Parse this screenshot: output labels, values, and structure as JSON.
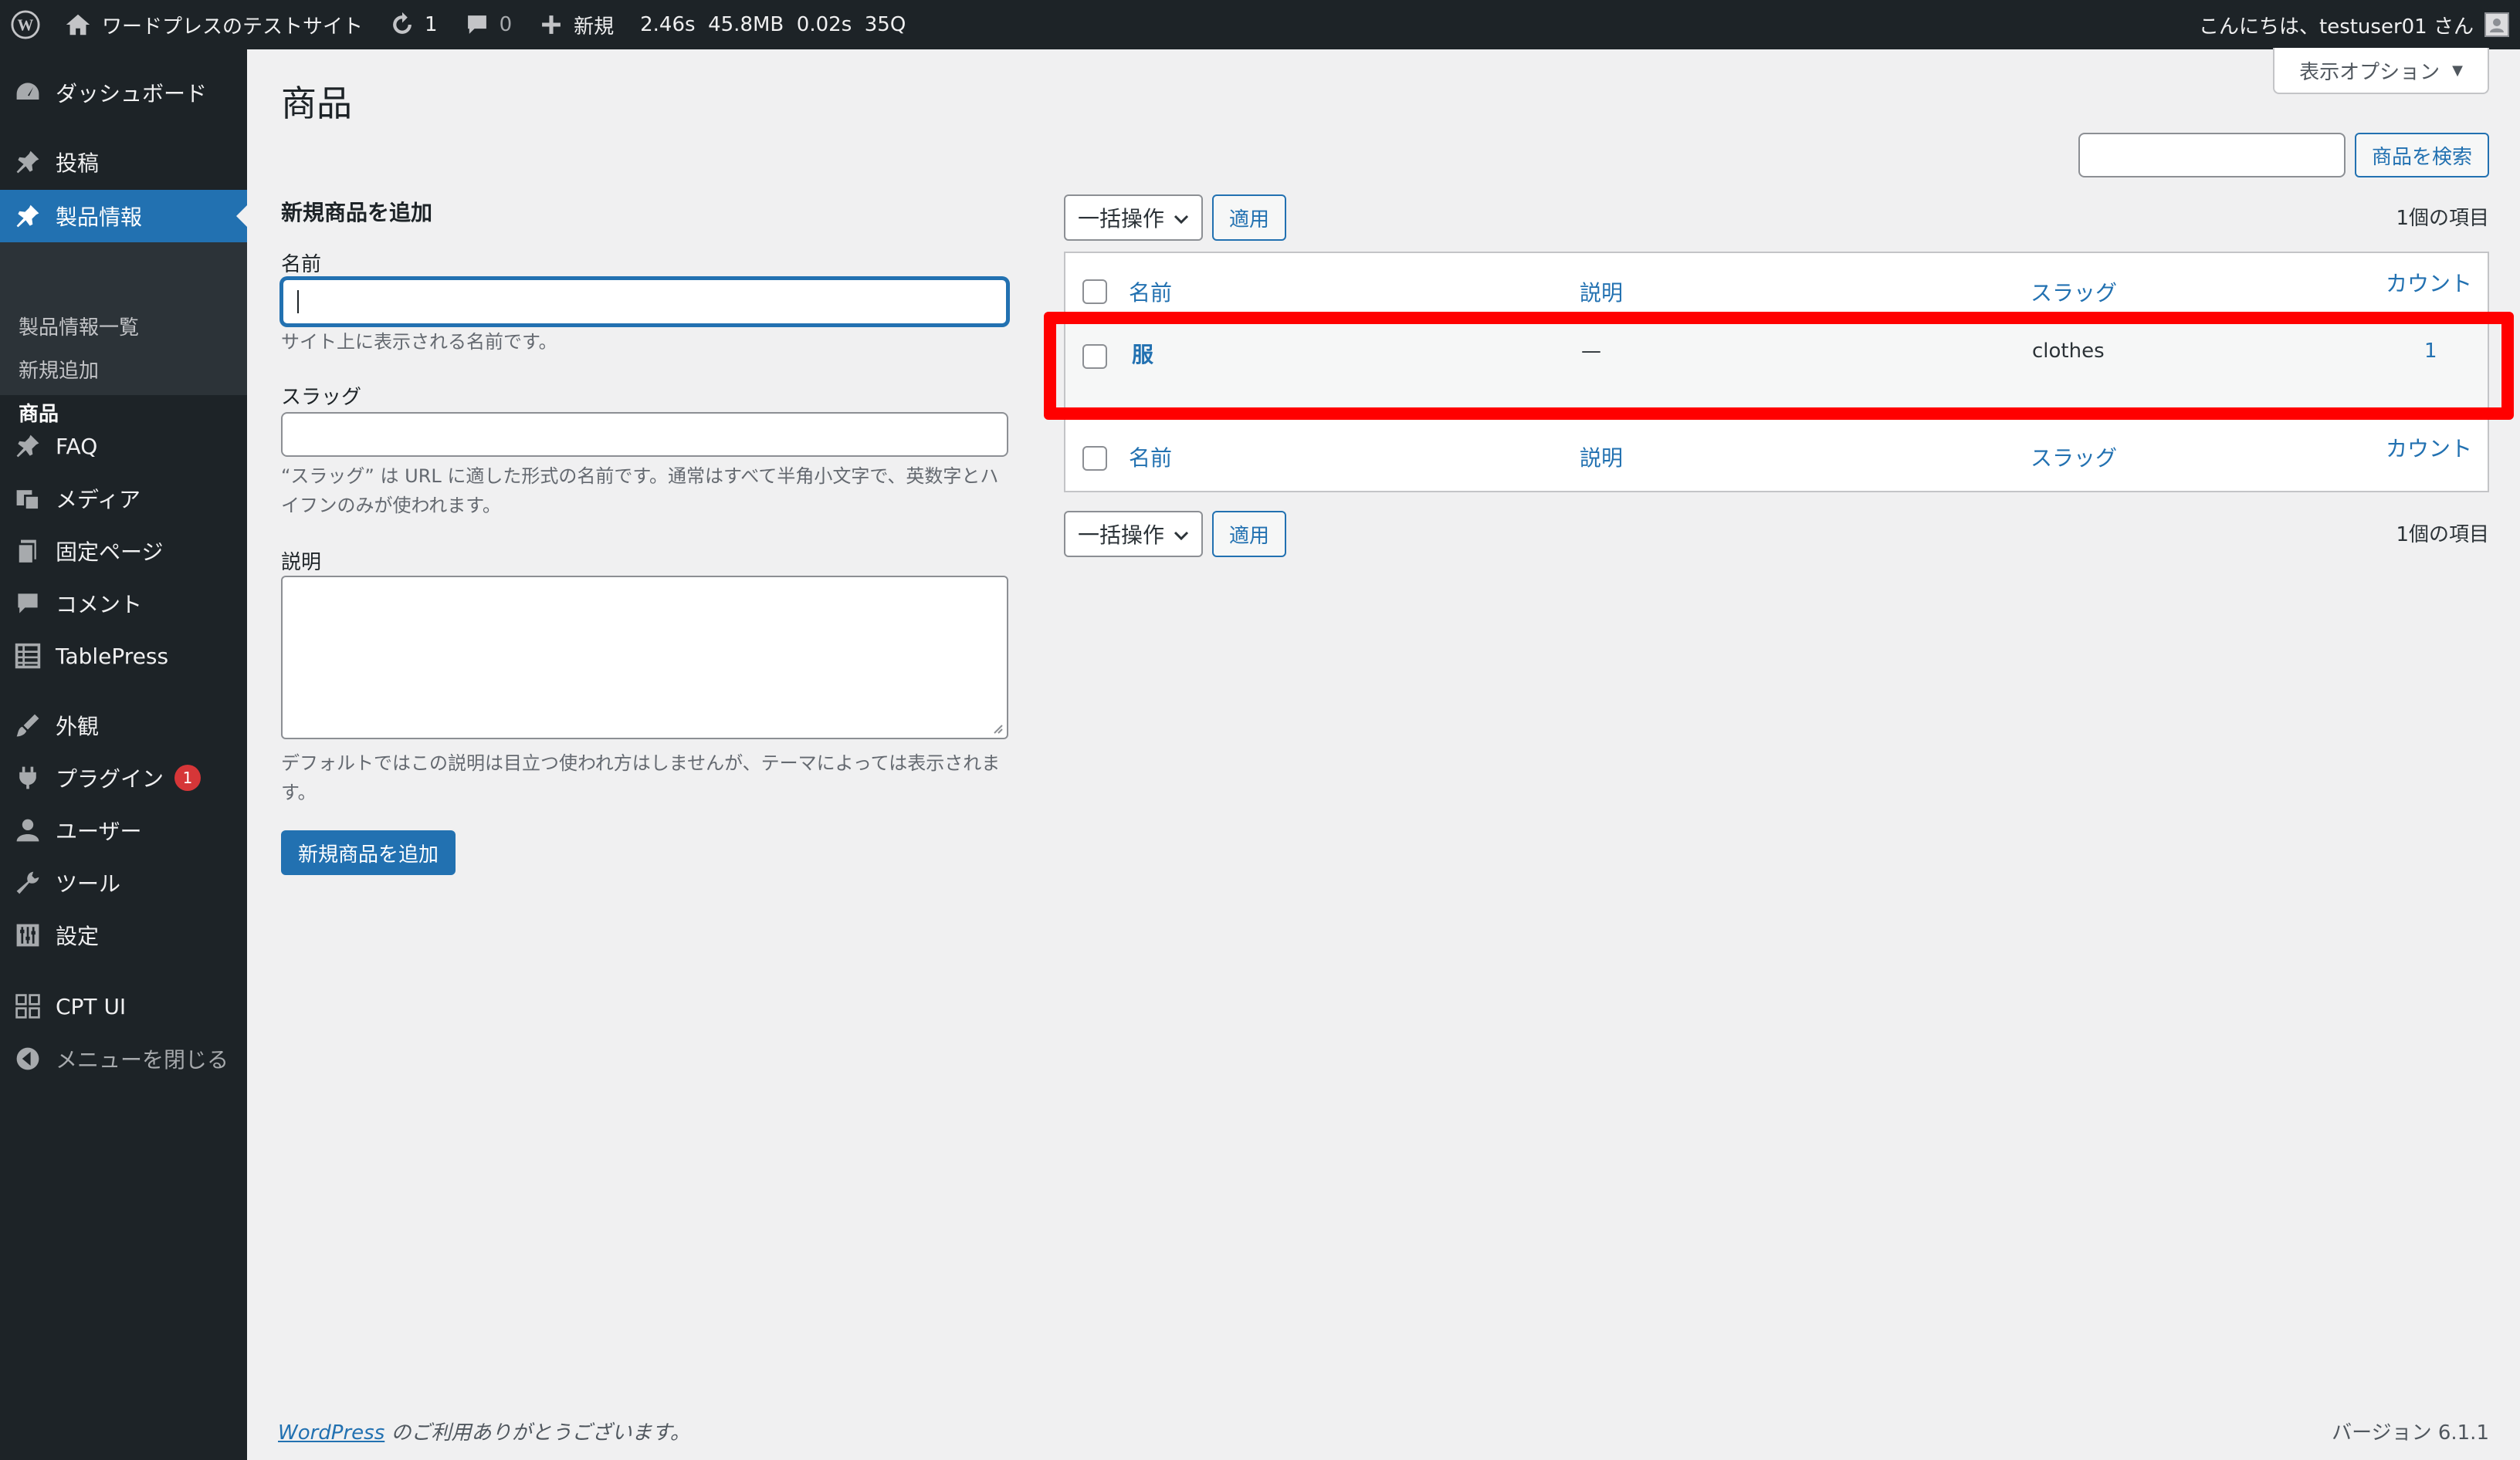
{
  "admin_bar": {
    "site_name": "ワードプレスのテストサイト",
    "updates_count": "1",
    "comments_count": "0",
    "new_label": "新規",
    "perf_time": "2.46s",
    "perf_memory": "45.8MB",
    "perf_query_time": "0.02s",
    "perf_queries": "35Q",
    "greeting": "こんにちは、testuser01 さん"
  },
  "sidebar": {
    "items": [
      {
        "label": "ダッシュボード",
        "icon": "dashboard-icon"
      },
      {
        "label": "投稿",
        "icon": "pin-icon"
      },
      {
        "label": "製品情報",
        "icon": "pin-icon"
      },
      {
        "label": "FAQ",
        "icon": "pin-icon"
      },
      {
        "label": "メディア",
        "icon": "media-icon"
      },
      {
        "label": "固定ページ",
        "icon": "page-icon"
      },
      {
        "label": "コメント",
        "icon": "comment-icon"
      },
      {
        "label": "TablePress",
        "icon": "table-icon"
      },
      {
        "label": "外観",
        "icon": "brush-icon"
      },
      {
        "label": "プラグイン",
        "icon": "plugin-icon"
      },
      {
        "label": "ユーザー",
        "icon": "user-icon"
      },
      {
        "label": "ツール",
        "icon": "wrench-icon"
      },
      {
        "label": "設定",
        "icon": "settings-icon"
      },
      {
        "label": "CPT UI",
        "icon": "grid-icon"
      },
      {
        "label": "メニューを閉じる",
        "icon": "collapse-icon"
      }
    ],
    "submenu": [
      "製品情報一覧",
      "新規追加",
      "商品"
    ],
    "plugin_badge": "1"
  },
  "header": {
    "title": "商品",
    "screen_options": "表示オプション"
  },
  "search": {
    "button": "商品を検索",
    "value": ""
  },
  "form": {
    "heading": "新規商品を追加",
    "name_label": "名前",
    "name_desc": "サイト上に表示される名前です。",
    "slug_label": "スラッグ",
    "slug_desc": "“スラッグ” は URL に適した形式の名前です。通常はすべて半角小文字で、英数字とハイフンのみが使われます。",
    "description_label": "説明",
    "description_desc": "デフォルトではこの説明は目立つ使われ方はしませんが、テーマによっては表示されます。",
    "submit": "新規商品を追加"
  },
  "bulk": {
    "select_label": "一括操作",
    "apply": "適用",
    "count": "1個の項目"
  },
  "table": {
    "columns": [
      "名前",
      "説明",
      "スラッグ",
      "カウント"
    ],
    "rows": [
      {
        "name": "服",
        "description": "—",
        "slug": "clothes",
        "count": "1"
      }
    ]
  },
  "footer": {
    "wp_link": "WordPress",
    "thanks": " のご利用ありがとうございます。",
    "version": "バージョン 6.1.1"
  },
  "colors": {
    "accent": "#2271b1",
    "admin_bg": "#1d2327",
    "highlight": "#ff0000"
  }
}
